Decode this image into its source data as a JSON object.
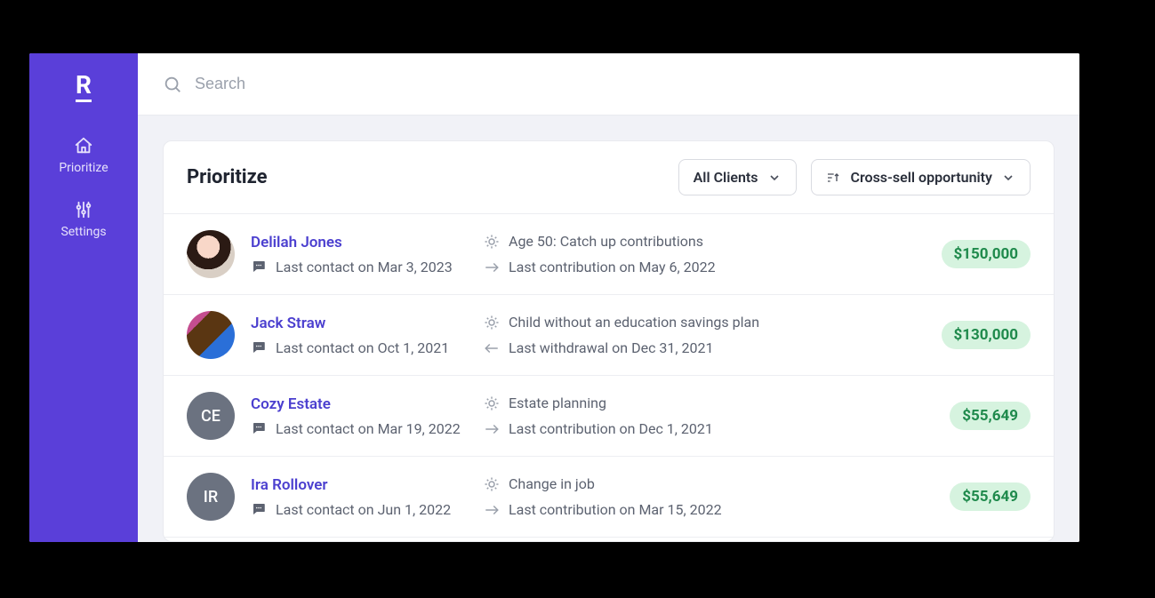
{
  "brand": {
    "logo_letter": "R"
  },
  "sidebar": {
    "items": [
      {
        "label": "Prioritize"
      },
      {
        "label": "Settings"
      }
    ]
  },
  "search": {
    "placeholder": "Search"
  },
  "panel": {
    "title": "Prioritize",
    "filter_label": "All Clients",
    "sort_label": "Cross-sell opportunity"
  },
  "clients": [
    {
      "name": "Delilah Jones",
      "last_contact": "Last contact on Mar 3, 2023",
      "insight": "Age 50: Catch up contributions",
      "activity": "Last contribution on May 6, 2022",
      "activity_dir": "right",
      "amount": "$150,000",
      "avatar_type": "photo1",
      "initials": ""
    },
    {
      "name": "Jack Straw",
      "last_contact": "Last contact on Oct 1, 2021",
      "insight": "Child without an education savings plan",
      "activity": "Last withdrawal on Dec 31, 2021",
      "activity_dir": "left",
      "amount": "$130,000",
      "avatar_type": "photo2",
      "initials": ""
    },
    {
      "name": "Cozy Estate",
      "last_contact": "Last contact on Mar 19, 2022",
      "insight": "Estate planning",
      "activity": "Last contribution on Dec 1, 2021",
      "activity_dir": "right",
      "amount": "$55,649",
      "avatar_type": "initials",
      "initials": "CE"
    },
    {
      "name": "Ira Rollover",
      "last_contact": "Last contact on Jun 1, 2022",
      "insight": "Change in job",
      "activity": "Last contribution on Mar 15, 2022",
      "activity_dir": "right",
      "amount": "$55,649",
      "avatar_type": "initials",
      "initials": "IR"
    }
  ]
}
